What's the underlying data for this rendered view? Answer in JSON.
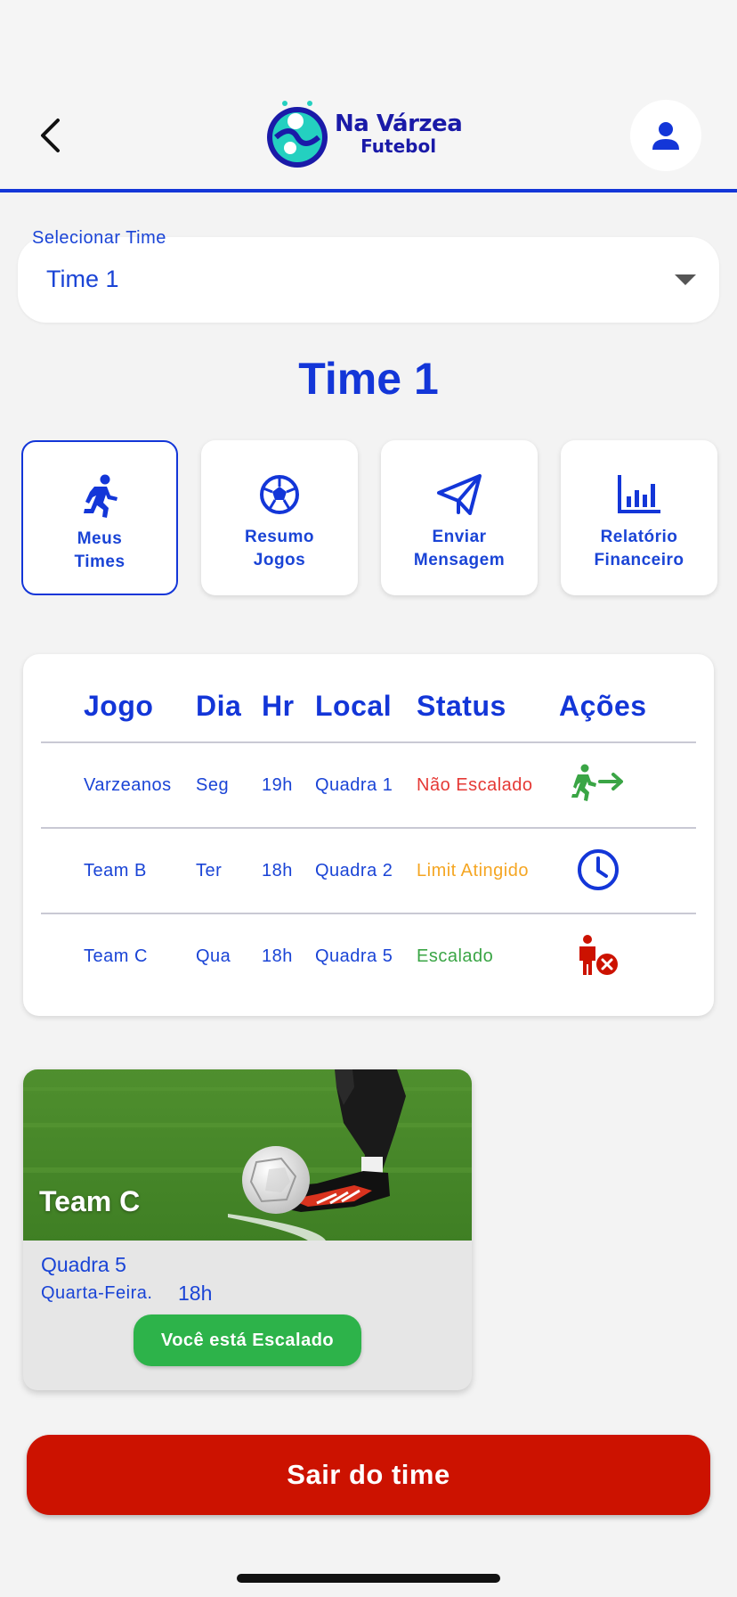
{
  "header": {
    "logo_title": "Na Várzea",
    "logo_subtitle": "Futebol",
    "back_icon": "chevron-left-icon",
    "profile_icon": "user-icon"
  },
  "team_select": {
    "label": "Selecionar Time",
    "value": "Time 1"
  },
  "team_title": "Time 1",
  "actions": [
    {
      "label_line1": "Meus",
      "label_line2": "Times",
      "icon": "running-person-icon",
      "active": true
    },
    {
      "label_line1": "Resumo",
      "label_line2": "Jogos",
      "icon": "soccer-ball-icon",
      "active": false
    },
    {
      "label_line1": "Enviar",
      "label_line2": "Mensagem",
      "icon": "send-icon",
      "active": false
    },
    {
      "label_line1": "Relatório",
      "label_line2": "Financeiro",
      "icon": "bar-chart-icon",
      "active": false
    }
  ],
  "table": {
    "headers": [
      "Jogo",
      "Dia",
      "Hr",
      "Local",
      "Status",
      "Ações"
    ],
    "rows": [
      {
        "jogo": "Varzeanos",
        "dia": "Seg",
        "hr": "19h",
        "local": "Quadra 1",
        "status": "Não Escalado",
        "status_color": "#e53935",
        "action_icon": "join-team-icon"
      },
      {
        "jogo": "Team B",
        "dia": "Ter",
        "hr": "18h",
        "local": "Quadra 2",
        "status": "Limit Atingido",
        "status_color": "#f5a623",
        "action_icon": "clock-icon"
      },
      {
        "jogo": "Team C",
        "dia": "Qua",
        "hr": "18h",
        "local": "Quadra 5",
        "status": "Escalado",
        "status_color": "#3aa545",
        "action_icon": "remove-player-icon"
      }
    ]
  },
  "game_card": {
    "team": "Team C",
    "court": "Quadra 5",
    "day": "Quarta-Feira.",
    "time": "18h",
    "button": "Você está Escalado"
  },
  "leave_button": "Sair do time",
  "colors": {
    "primary": "#1336d8",
    "danger": "#cc1200",
    "success": "#2db34a",
    "warning": "#f5a623"
  }
}
